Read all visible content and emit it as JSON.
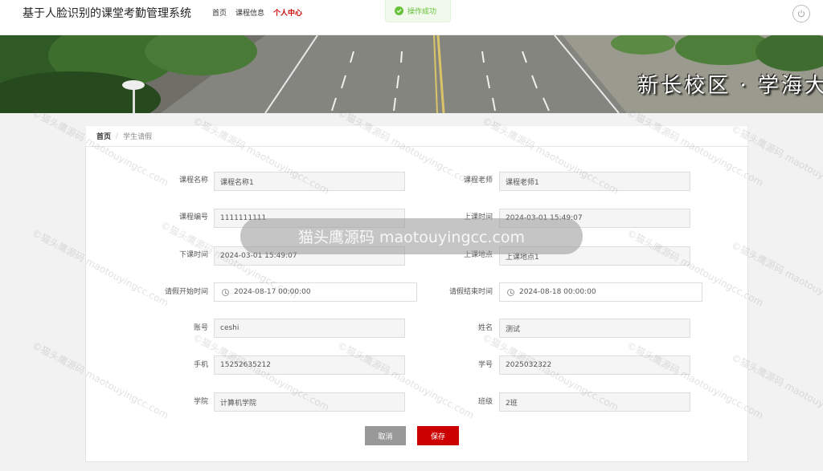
{
  "header": {
    "title": "基于人脸识别的课堂考勤管理系统",
    "nav": [
      {
        "label": "首页",
        "active": false
      },
      {
        "label": "课程信息",
        "active": false
      },
      {
        "label": "个人中心",
        "active": true
      }
    ]
  },
  "toast": {
    "text": "操作成功",
    "type": "success",
    "color": "#67c23a"
  },
  "banner": {
    "text": "新长校区 · 学海大"
  },
  "breadcrumb": {
    "home": "首页",
    "separator": "/",
    "current": "学生请假"
  },
  "form": {
    "course_name": {
      "label": "课程名称",
      "value": "课程名称1"
    },
    "teacher": {
      "label": "课程老师",
      "value": "课程老师1"
    },
    "course_code": {
      "label": "课程编号",
      "value": "1111111111"
    },
    "class_start": {
      "label": "上课时间",
      "value": "2024-03-01 15:49:07"
    },
    "class_end": {
      "label": "下课时间",
      "value": "2024-03-01 15:49:07"
    },
    "location": {
      "label": "上课地点",
      "value": "上课地点1"
    },
    "leave_start": {
      "label": "请假开始时间",
      "value": "2024-08-17 00:00:00"
    },
    "leave_end": {
      "label": "请假结束时间",
      "value": "2024-08-18 00:00:00"
    },
    "account": {
      "label": "账号",
      "value": "ceshi"
    },
    "name": {
      "label": "姓名",
      "value": "测试"
    },
    "phone": {
      "label": "手机",
      "value": "15252635212"
    },
    "student_id": {
      "label": "学号",
      "value": "2025032322"
    },
    "college": {
      "label": "学院",
      "value": "计算机学院"
    },
    "class": {
      "label": "班级",
      "value": "2班"
    }
  },
  "buttons": {
    "cancel": "取消",
    "save": "保存"
  },
  "watermark": {
    "center": "猫头鹰源码 maotouyingcc.com",
    "tile": "©猫头鹰源码 maotouyingcc.com"
  },
  "colors": {
    "accent": "#cc0000",
    "success": "#67c23a",
    "cancel": "#999999"
  }
}
